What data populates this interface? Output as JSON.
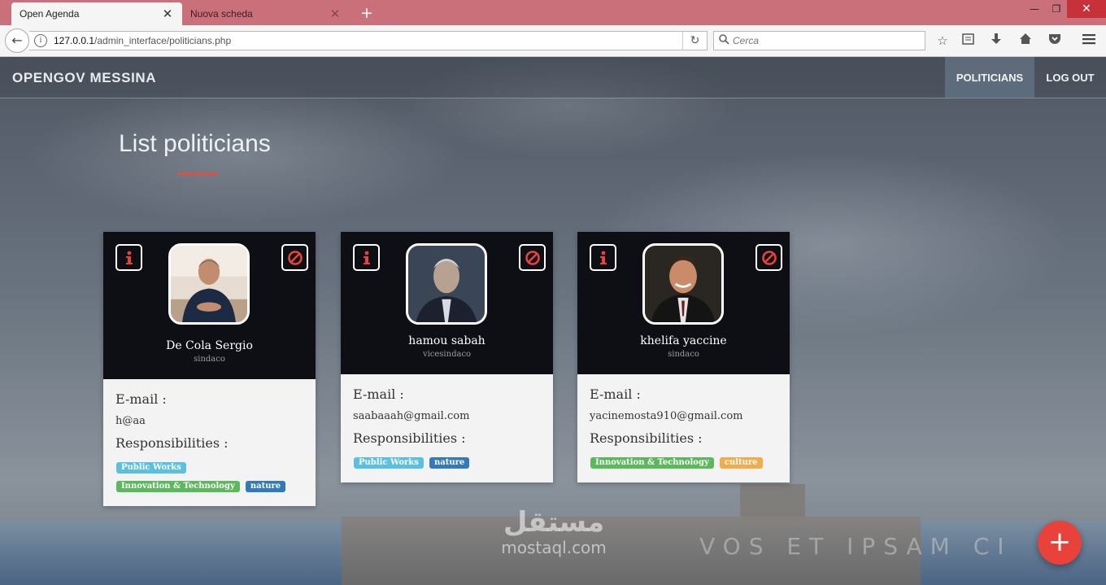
{
  "browser": {
    "tabs": [
      {
        "title": "Open Agenda",
        "active": true
      },
      {
        "title": "Nuova scheda",
        "active": false
      }
    ],
    "new_tab": "+",
    "url": {
      "host": "127.0.0.1",
      "path": "/admin_interface/politicians.php"
    },
    "search": {
      "placeholder": "Cerca"
    },
    "tab_color": "#c9707b"
  },
  "app": {
    "brand": "OPENGOV MESSINA",
    "nav": [
      {
        "label": "POLITICIANS",
        "active": true
      },
      {
        "label": "LOG OUT",
        "active": false
      }
    ],
    "page_title": "List politicians",
    "accent_color": "#e0503e"
  },
  "labels": {
    "email": "E-mail :",
    "responsibilities": "Responsibilities :"
  },
  "tag_colors": {
    "Public Works": "#5bc0de",
    "Innovation & Technology": "#5cb85c",
    "nature": "#337ab7",
    "culture": "#f0ad4e"
  },
  "politicians": [
    {
      "name": "De Cola Sergio",
      "role": "sindaco",
      "email": "h@aa",
      "responsibilities": [
        "Public Works",
        "Innovation & Technology",
        "nature"
      ]
    },
    {
      "name": "hamou sabah",
      "role": "vicesindaco",
      "email": "saabaaah@gmail.com",
      "responsibilities": [
        "Public Works",
        "nature"
      ]
    },
    {
      "name": "khelifa yaccine",
      "role": "sindaco",
      "email": "yacinemosta910@gmail.com",
      "responsibilities": [
        "Innovation & Technology",
        "culture"
      ]
    }
  ],
  "fab": {
    "label": "+"
  },
  "watermark": {
    "arabic": "مستقل",
    "latin": "mostaql.com"
  },
  "background_text": "VOS ET IPSAM CI"
}
